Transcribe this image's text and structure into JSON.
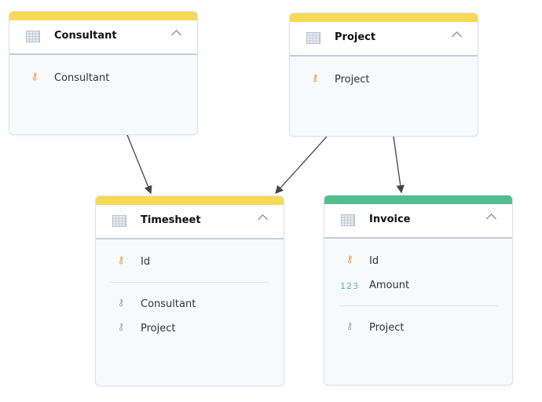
{
  "colors": {
    "dimension": "#f8d957",
    "fact": "#52bd8f",
    "key": "#f0903a",
    "ref_key": "#a0a6b0"
  },
  "tables": {
    "consultant": {
      "title": "Consultant",
      "fields": [
        {
          "icon": "primary-key-icon",
          "label": "Consultant"
        }
      ]
    },
    "project": {
      "title": "Project",
      "fields": [
        {
          "icon": "primary-key-icon",
          "label": "Project"
        }
      ]
    },
    "timesheet": {
      "title": "Timesheet",
      "fields": [
        {
          "icon": "primary-key-icon",
          "label": "Id"
        },
        {
          "icon": "reference-key-icon",
          "label": "Consultant"
        },
        {
          "icon": "reference-key-icon",
          "label": "Project"
        }
      ]
    },
    "invoice": {
      "title": "Invoice",
      "fields": [
        {
          "icon": "primary-key-icon",
          "label": "Id"
        },
        {
          "icon": "number-icon",
          "label": "Amount",
          "glyph": "123"
        },
        {
          "icon": "reference-key-icon",
          "label": "Project"
        }
      ]
    }
  },
  "relationships": [
    {
      "from": "Consultant",
      "to": "Timesheet"
    },
    {
      "from": "Project",
      "to": "Timesheet"
    },
    {
      "from": "Project",
      "to": "Invoice"
    }
  ]
}
